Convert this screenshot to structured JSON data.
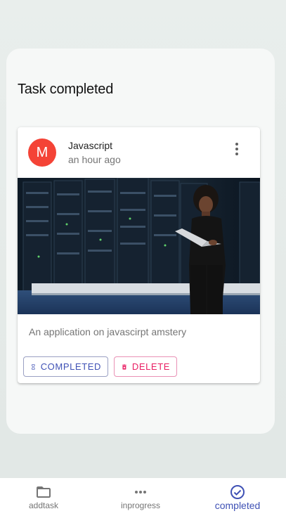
{
  "panel": {
    "title": "Task completed"
  },
  "card": {
    "avatar_letter": "M",
    "title": "Javascript",
    "subheader": "an hour ago",
    "description": "An application on javascirpt amstery",
    "buttons": {
      "completed": "COMPLETED",
      "delete": "DELETE"
    }
  },
  "bottom_nav": {
    "items": [
      {
        "label": "addtask",
        "icon": "folder-icon",
        "active": false
      },
      {
        "label": "inprogress",
        "icon": "more-horiz-icon",
        "active": false
      },
      {
        "label": "completed",
        "icon": "check-circle-icon",
        "active": true
      }
    ]
  },
  "colors": {
    "primary": "#3f51b5",
    "secondary": "#e91e63",
    "avatar": "#f44336"
  }
}
